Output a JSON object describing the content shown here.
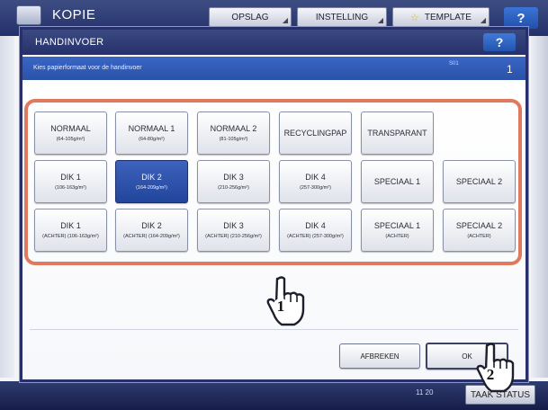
{
  "background": {
    "app_title": "KOPIE",
    "tabs": [
      "OPSLAG",
      "INSTELLING",
      "TEMPLATE"
    ],
    "help_label": "?",
    "clock": "11 20",
    "job_status_label": "TAAK STATUS"
  },
  "dialog": {
    "title": "HANDINVOER",
    "help_label": "?",
    "message": "Kies papierformaat voor de handinvoer",
    "code": "S01",
    "page": "1",
    "paper_types": [
      {
        "label": "NORMAAL",
        "sub": "(64-105g/m²)",
        "selected": false
      },
      {
        "label": "NORMAAL 1",
        "sub": "(64-80g/m²)",
        "selected": false
      },
      {
        "label": "NORMAAL 2",
        "sub": "(81-105g/m²)",
        "selected": false
      },
      {
        "label": "RECYCLINGPAP",
        "sub": "",
        "selected": false
      },
      {
        "label": "TRANSPARANT",
        "sub": "",
        "selected": false
      },
      {
        "label": "DIK 1",
        "sub": "(106-163g/m²)",
        "selected": false
      },
      {
        "label": "DIK 2",
        "sub": "(164-209g/m²)",
        "selected": true
      },
      {
        "label": "DIK 3",
        "sub": "(210-256g/m²)",
        "selected": false
      },
      {
        "label": "DIK 4",
        "sub": "(257-300g/m²)",
        "selected": false
      },
      {
        "label": "SPECIAAL 1",
        "sub": "",
        "selected": false
      },
      {
        "label": "SPECIAAL 2",
        "sub": "",
        "selected": false
      },
      {
        "label": "DIK 1",
        "sub": "(ACHTER) (106-163g/m²)",
        "selected": false
      },
      {
        "label": "DIK 2",
        "sub": "(ACHTER) (164-209g/m²)",
        "selected": false
      },
      {
        "label": "DIK 3",
        "sub": "(ACHTER) (210-256g/m²)",
        "selected": false
      },
      {
        "label": "DIK 4",
        "sub": "(ACHTER) (257-300g/m²)",
        "selected": false
      },
      {
        "label": "SPECIAAL 1",
        "sub": "(ACHTER)",
        "selected": false
      },
      {
        "label": "SPECIAAL 2",
        "sub": "(ACHTER)",
        "selected": false
      }
    ],
    "cancel_label": "AFBREKEN",
    "ok_label": "OK"
  },
  "callouts": {
    "step1": "1",
    "step2": "2"
  },
  "colors": {
    "header_navy": "#26306a",
    "message_blue": "#2a52a8",
    "selected_blue": "#22449b",
    "highlight_orange": "#e07a5f"
  },
  "icons": {
    "step1": "pointing-hand-icon",
    "step2": "pointing-hand-icon"
  }
}
